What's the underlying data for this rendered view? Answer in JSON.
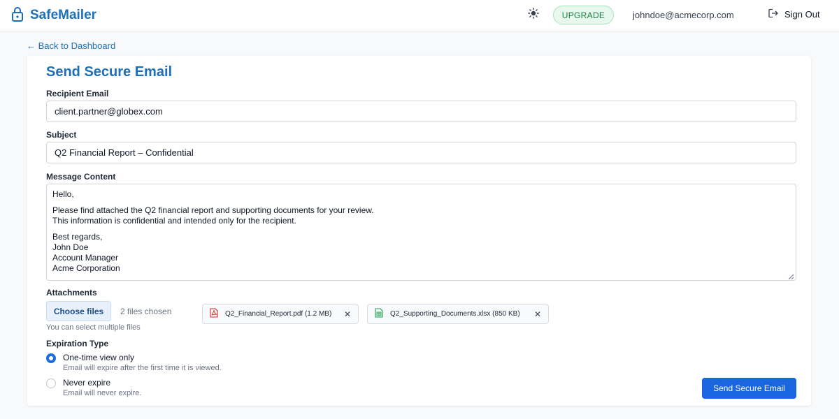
{
  "header": {
    "brand": "SafeMailer",
    "upgrade_label": "UPGRADE",
    "user_email": "johndoe@acmecorp.com",
    "signout_label": "Sign Out",
    "icons": {
      "brand": "lock-icon",
      "theme": "sun-icon",
      "signout": "sign-out-icon"
    }
  },
  "nav": {
    "back_label": "← Back to Dashboard"
  },
  "form": {
    "title": "Send Secure Email",
    "recipient": {
      "label": "Recipient Email",
      "value": "client.partner@globex.com"
    },
    "subject": {
      "label": "Subject",
      "value": "Q2 Financial Report – Confidential"
    },
    "message": {
      "label": "Message Content",
      "greeting": "Hello,",
      "line1": "Please find attached the Q2 financial report and supporting documents for your review.",
      "line2": "This information is confidential and intended only for the recipient.",
      "closing": "Best regards,",
      "sig_name": "John Doe",
      "sig_title": "Account Manager",
      "sig_company": "Acme Corporation"
    },
    "attachments": {
      "label": "Attachments",
      "choose_label": "Choose files",
      "chosen_text": "2 files chosen",
      "hint": "You can select multiple files",
      "files": [
        {
          "name": "Q2_Financial_Report.pdf (1.2 MB)",
          "icon": "pdf-file-icon",
          "color": "#dc2626"
        },
        {
          "name": "Q2_Supporting_Documents.xlsx (850 KB)",
          "icon": "spreadsheet-file-icon",
          "color": "#16a34a"
        }
      ]
    },
    "expiration": {
      "label": "Expiration Type",
      "selected": "One-time view only",
      "options": [
        {
          "title": "One-time view only",
          "desc": "Email will expire after the first time it is viewed."
        },
        {
          "title": "Never expire",
          "desc": "Email will never expire."
        }
      ]
    },
    "send_label": "Send Secure Email"
  },
  "colors": {
    "brand": "#1d6fb8",
    "primary_button": "#1a66e0",
    "upgrade_green": "#15803d"
  }
}
